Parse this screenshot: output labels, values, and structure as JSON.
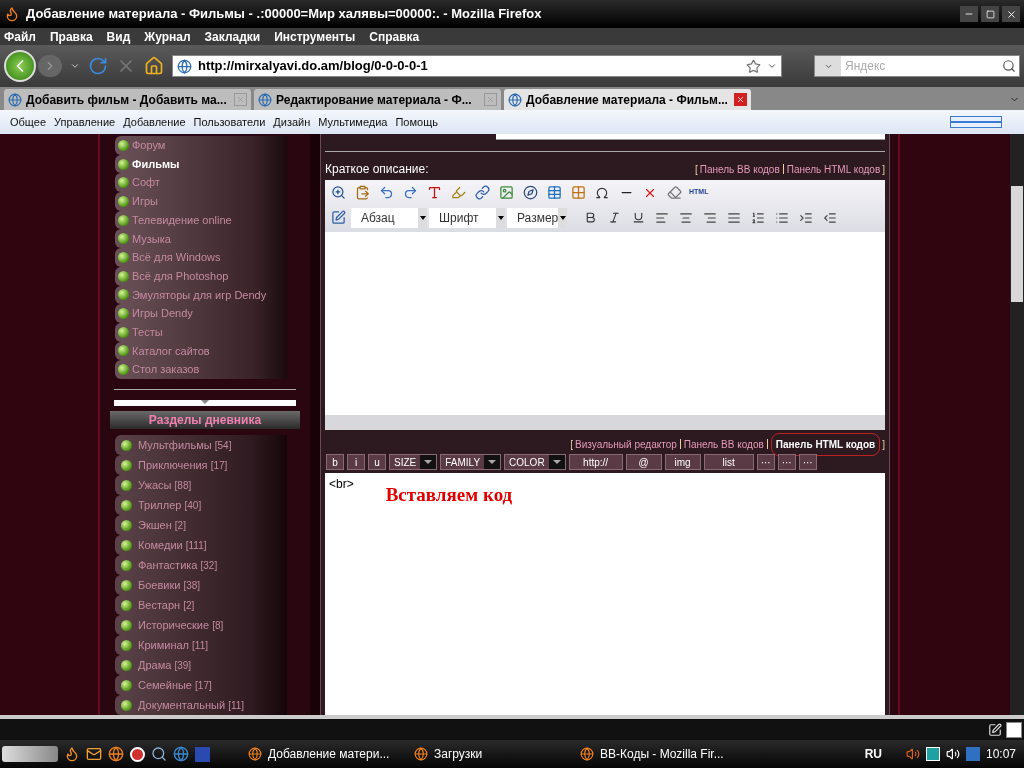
{
  "window": {
    "title": "Добавление материала - Фильмы - .:00000=Мир халявы=00000:. - Mozilla Firefox"
  },
  "menu": [
    "Файл",
    "Правка",
    "Вид",
    "Журнал",
    "Закладки",
    "Инструменты",
    "Справка"
  ],
  "address": {
    "value": "http://mirxalyavi.do.am/blog/0-0-0-0-1"
  },
  "search": {
    "placeholder": "Яндекс"
  },
  "tabs": [
    {
      "label": "Добавить фильм - Добавить ма...",
      "selected": false
    },
    {
      "label": "Редактирование материала - Ф...",
      "selected": false
    },
    {
      "label": "Добавление материала - Фильм...",
      "selected": true
    }
  ],
  "site_menu": [
    "Общее",
    "Управление",
    "Добавление",
    "Пользователи",
    "Дизайн",
    "Мультимедиа",
    "Помощь"
  ],
  "sidebar": {
    "items": [
      {
        "label": "Форум",
        "selected": false
      },
      {
        "label": "Фильмы",
        "selected": true
      },
      {
        "label": "Софт",
        "selected": false
      },
      {
        "label": "Игры",
        "selected": false
      },
      {
        "label": "Телевидение online",
        "selected": false
      },
      {
        "label": "Музыка",
        "selected": false
      },
      {
        "label": "Всё для Windows",
        "selected": false
      },
      {
        "label": "Всё для Photoshop",
        "selected": false
      },
      {
        "label": "Эмуляторы для игр Dendy",
        "selected": false
      },
      {
        "label": "Игры Dendy",
        "selected": false
      },
      {
        "label": "Тесты",
        "selected": false
      },
      {
        "label": "Каталог сайтов",
        "selected": false
      },
      {
        "label": "Стол заказов",
        "selected": false
      }
    ],
    "section_title": "Разделы дневника",
    "categories": [
      {
        "label": "Мультфильмы",
        "count": "[54]"
      },
      {
        "label": "Приключения",
        "count": "[17]"
      },
      {
        "label": "Ужасы",
        "count": "[88]"
      },
      {
        "label": "Триллер",
        "count": "[40]"
      },
      {
        "label": "Экшен",
        "count": "[2]"
      },
      {
        "label": "Комедии",
        "count": "[111]"
      },
      {
        "label": "Фантастика",
        "count": "[32]"
      },
      {
        "label": "Боевики",
        "count": "[38]"
      },
      {
        "label": "Вестарн",
        "count": "[2]"
      },
      {
        "label": "Исторические",
        "count": "[8]"
      },
      {
        "label": "Криминал",
        "count": "[11]"
      },
      {
        "label": "Драма",
        "count": "[39]"
      },
      {
        "label": "Семейные",
        "count": "[17]"
      },
      {
        "label": "Документальный",
        "count": "[11]"
      }
    ]
  },
  "editor": {
    "label": "Краткое описание:",
    "brackets": [
      "[",
      "]"
    ],
    "top_links": [
      {
        "label": "Панель BB кодов",
        "selected": false
      },
      {
        "label": "Панель HTML кодов",
        "selected": false
      }
    ],
    "html_icon_label": "HTML",
    "selects": [
      "Абзац",
      "Шрифт",
      "Размер"
    ],
    "bottom_links": [
      {
        "label": "Визуальный редактор",
        "selected": false
      },
      {
        "label": "Панель BB кодов",
        "selected": false
      },
      {
        "label": "Панель HTML кодов",
        "selected": true
      }
    ],
    "code_buttons": [
      {
        "label": "b",
        "kind": "plain"
      },
      {
        "label": "i",
        "kind": "plain"
      },
      {
        "label": "u",
        "kind": "plain"
      },
      {
        "label": "SIZE",
        "kind": "dropdown"
      },
      {
        "label": "FAMILY",
        "kind": "dropdown"
      },
      {
        "label": "COLOR",
        "kind": "dropdown"
      },
      {
        "label": "http://",
        "kind": "wide"
      },
      {
        "label": "@",
        "kind": "wide"
      },
      {
        "label": "img",
        "kind": "wide"
      },
      {
        "label": "list",
        "kind": "wide"
      },
      {
        "label": "···",
        "kind": "plain"
      },
      {
        "label": "···",
        "kind": "plain"
      },
      {
        "label": "···",
        "kind": "plain"
      }
    ],
    "code": "<br>",
    "annotation": "Вставляем код"
  },
  "taskbar": {
    "tasks": [
      "Добавление матери...",
      "Загрузки",
      "BB-Коды - Mozilla Fir..."
    ],
    "language": "RU",
    "clock": "10:07"
  }
}
